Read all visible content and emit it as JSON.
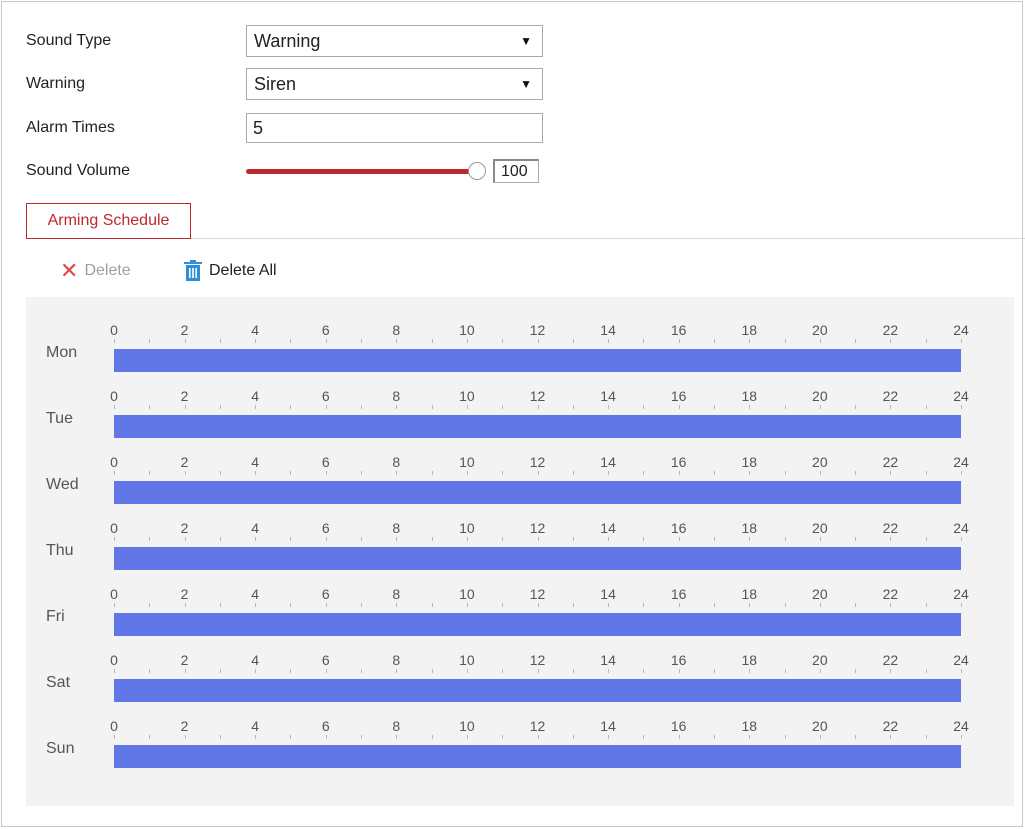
{
  "form": {
    "sound_type": {
      "label": "Sound Type",
      "value": "Warning"
    },
    "warning": {
      "label": "Warning",
      "value": "Siren"
    },
    "alarm_times": {
      "label": "Alarm Times",
      "value": "5"
    },
    "sound_volume": {
      "label": "Sound Volume",
      "value": "100",
      "level_percent": 100
    }
  },
  "tabs": [
    {
      "label": "Arming Schedule",
      "active": true
    }
  ],
  "toolbar": {
    "delete_label": "Delete",
    "delete_all_label": "Delete All"
  },
  "schedule": {
    "tick_labels": [
      "0",
      "2",
      "4",
      "6",
      "8",
      "10",
      "12",
      "14",
      "16",
      "18",
      "20",
      "22",
      "24"
    ],
    "bar_color": "#6277e7",
    "days": [
      {
        "name": "Mon",
        "segments": [
          [
            0,
            24
          ]
        ]
      },
      {
        "name": "Tue",
        "segments": [
          [
            0,
            24
          ]
        ]
      },
      {
        "name": "Wed",
        "segments": [
          [
            0,
            24
          ]
        ]
      },
      {
        "name": "Thu",
        "segments": [
          [
            0,
            24
          ]
        ]
      },
      {
        "name": "Fri",
        "segments": [
          [
            0,
            24
          ]
        ]
      },
      {
        "name": "Sat",
        "segments": [
          [
            0,
            24
          ]
        ]
      },
      {
        "name": "Sun",
        "segments": [
          [
            0,
            24
          ]
        ]
      }
    ]
  },
  "colors": {
    "accent": "#c0282f",
    "delete_icon": "#e04848",
    "trash_icon": "#2f8fd6"
  }
}
